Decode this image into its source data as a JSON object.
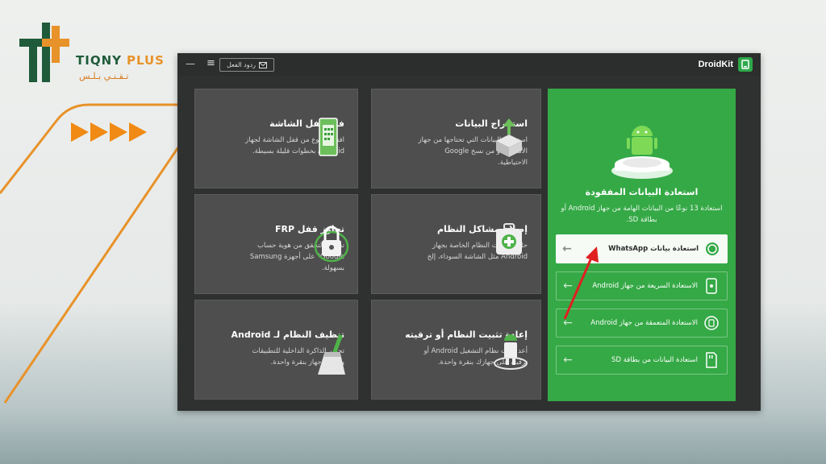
{
  "brand": {
    "name": "TIQNY",
    "plus": "PLUS",
    "arabic": "تـقـنـي  بـلـس"
  },
  "colors": {
    "brand_green": "#1f5b3a",
    "brand_orange": "#e8922a",
    "app_green": "#35a946",
    "app_dark": "#2f3130",
    "pointer_red": "#e02020"
  },
  "app": {
    "title": "DroidKit",
    "feedback_label": "ردود الفعل",
    "menu_icon": "hamburger-icon",
    "mail_icon": "mail-icon"
  },
  "cards": [
    {
      "id": "screen-unlock",
      "title": "فتح قفل الشاشة",
      "desc": "افتح أي نوع من قفل الشاشة لجهاز Android بخطوات قليلة بسيطة.",
      "icon": "phone-unlock-icon"
    },
    {
      "id": "data-extract",
      "title": "استخراج البيانات",
      "desc": "استخراج البيانات التي تحتاجها من جهاز الأندرويد أو من نسخ Google الاحتياطية.",
      "icon": "data-extract-icon"
    },
    {
      "id": "frp-bypass",
      "title": "تجاوز قفل FRP",
      "desc": "تجاوز \"التحقق من هوية حساب Google\" على أجهزة Samsung بسهولة.",
      "icon": "padlock-icon"
    },
    {
      "id": "system-fix",
      "title": "إصلاح مشاكل النظام",
      "desc": "حل مشكلات النظام الخاصة بجهاز Android مثل الشاشة السوداء، إلخ",
      "icon": "repair-kit-icon"
    },
    {
      "id": "system-clean",
      "title": "تنظيف النظام لـ Android",
      "desc": "تحرير الذاكرة الداخلية للتطبيقات وتسريع جهاز بنقرة واحدة.",
      "icon": "broom-icon"
    },
    {
      "id": "reinstall",
      "title": "إعادة تثبيت النظام أو ترقيته",
      "desc": "أعد تثبيت نظام التشغيل Android أو ترقيته على جهازك بنقرة واحدة.",
      "icon": "android-upgrade-icon"
    }
  ],
  "recovery": {
    "title": "استعادة البيانات المفقودة",
    "desc": "استعادة 13 نوعًا من البيانات الهامة من جهاز Android أو بطاقة SD.",
    "icon": "android-robot-icon",
    "options": [
      {
        "label": "استعادة بيانات WhatsApp",
        "icon": "whatsapp-icon"
      },
      {
        "label": "الاستعادة السريعة من جهاز Android",
        "icon": "phone-icon"
      },
      {
        "label": "الاستعادة المتعمقة من جهاز Android",
        "icon": "deep-scan-icon"
      },
      {
        "label": "استعادة البيانات من بطاقة SD",
        "icon": "sd-card-icon"
      }
    ]
  }
}
